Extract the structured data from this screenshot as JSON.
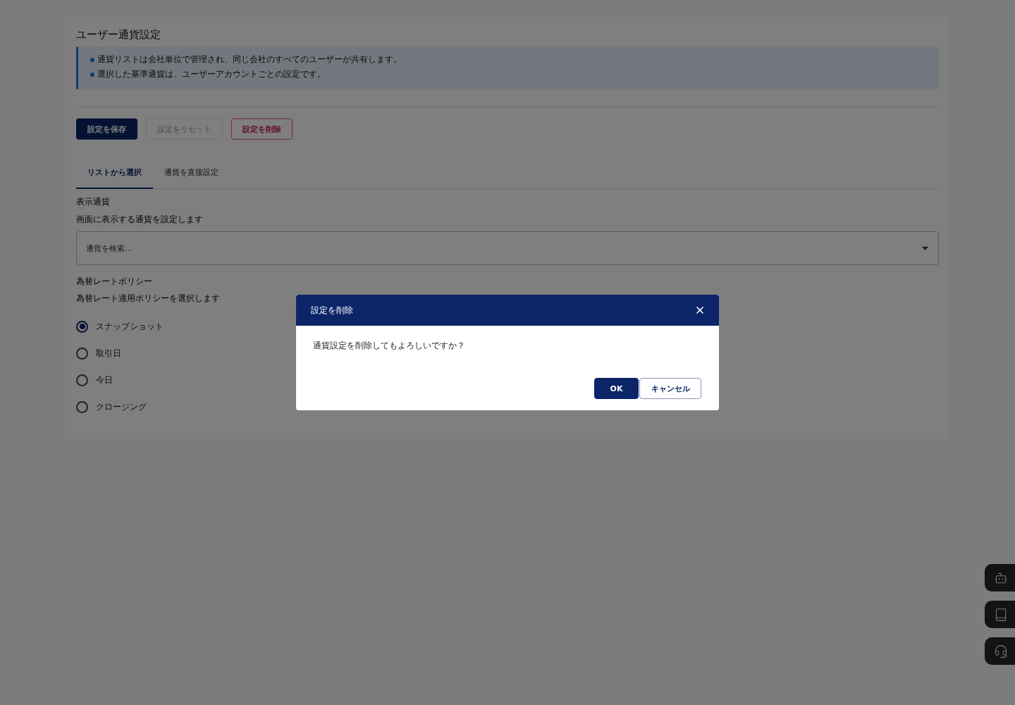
{
  "page": {
    "title": "ユーザー通貨設定"
  },
  "info": {
    "items": [
      "通貨リストは会社単位で管理され、同じ会社のすべてのユーザーが共有します。",
      "選択した基準通貨は、ユーザーアカウントごとの設定です。"
    ]
  },
  "actions": [
    {
      "label": "設定を保存",
      "kind": "primary",
      "disabled": false
    },
    {
      "label": "設定をリセット",
      "kind": "secondary",
      "disabled": true
    },
    {
      "label": "設定を削除",
      "kind": "danger",
      "disabled": false
    }
  ],
  "tabs": [
    {
      "label": "リストから選択",
      "selected": true
    },
    {
      "label": "通貨を直接設定",
      "selected": false
    }
  ],
  "display_currency": {
    "label": "表示通貨",
    "description": "画面に表示する通貨を設定します",
    "placeholder": "通貨を検索..."
  },
  "rate_policy": {
    "label": "為替レートポリシー",
    "description": "為替レート適用ポリシーを選択します",
    "options": [
      {
        "label": "スナップショット",
        "selected": true
      },
      {
        "label": "取引日",
        "selected": false
      },
      {
        "label": "今日",
        "selected": false
      },
      {
        "label": "クロージング",
        "selected": false
      }
    ]
  },
  "dialog": {
    "title": "設定を削除",
    "message": "通貨設定を削除してもよろしいですか？",
    "buttons": [
      {
        "label": "OK",
        "kind": "primary"
      },
      {
        "label": "キャンセル",
        "kind": "secondary"
      }
    ]
  },
  "side_buttons": [
    {
      "kind": "bot"
    },
    {
      "kind": "book"
    },
    {
      "kind": "support"
    }
  ]
}
